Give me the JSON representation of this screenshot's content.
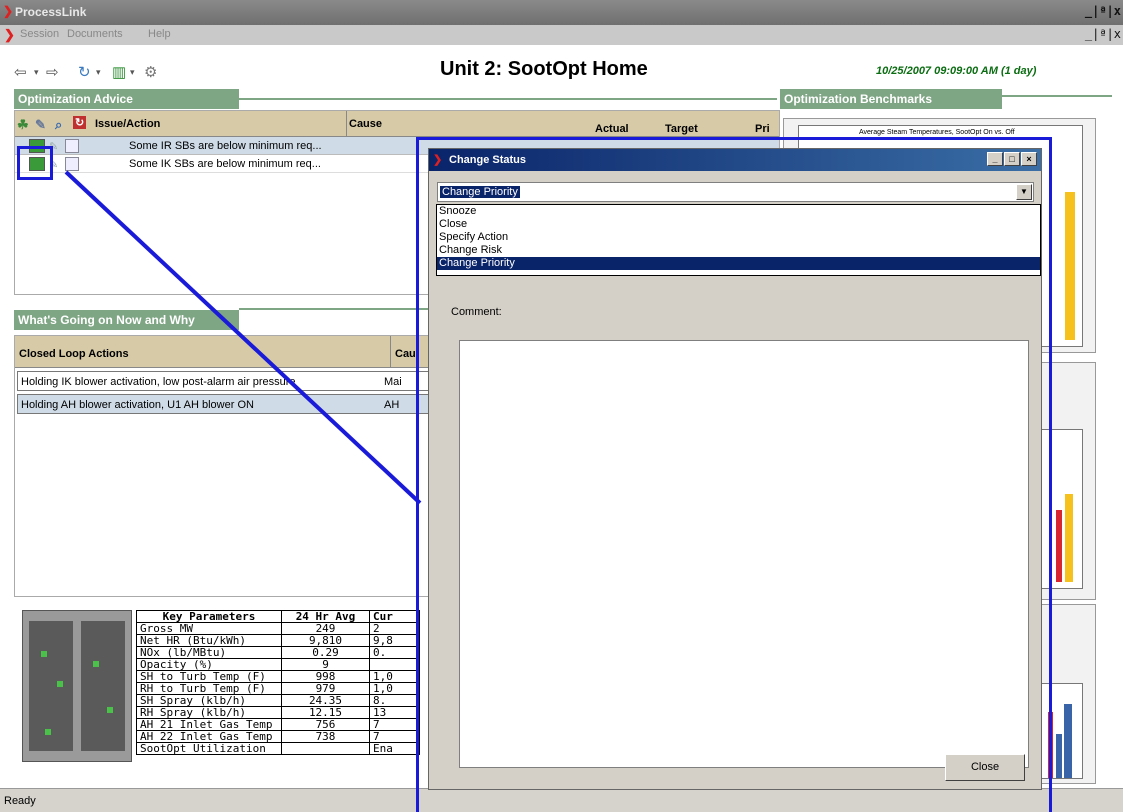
{
  "window": {
    "title": "ProcessLink",
    "controls": "_|ª|x"
  },
  "menu": {
    "items": [
      "Session",
      "Documents",
      "Help"
    ],
    "controls": "_|ª|x"
  },
  "toolbar": {
    "icons": [
      "back-arrow-icon",
      "forward-arrow-icon",
      "refresh-icon",
      "chart-icon",
      "settings-icon"
    ]
  },
  "header": {
    "title": "Unit 2: SootOpt Home",
    "datetime": "10/25/2007 09:09:00 AM (1 day)"
  },
  "optimization_advice": {
    "title": "Optimization Advice",
    "columns": [
      "Issue/Action",
      "Cause",
      "Actual",
      "Target",
      "Pri"
    ],
    "rows": [
      {
        "issue": "Some IR SBs are below minimum req..."
      },
      {
        "issue": "Some IK SBs are below minimum req..."
      }
    ]
  },
  "benchmarks": {
    "title": "Optimization Benchmarks",
    "chart1_title": "Average Steam Temperatures, SootOpt On vs. Off",
    "colors": {
      "yellow": "#f6c11c",
      "red": "#d7262f",
      "blue": "#3a64a8"
    }
  },
  "whats_going_on": {
    "title": "What's Going on Now and Why",
    "columns": [
      "Closed Loop Actions",
      "Cau"
    ],
    "rows": [
      {
        "action": "Holding IK blower activation, low post-alarm air pressure",
        "cause": "Mai"
      },
      {
        "action": "Holding AH blower activation, U1 AH blower ON",
        "cause": "AH"
      }
    ]
  },
  "key_parameters": {
    "headers": [
      "Key Parameters",
      "24 Hr Avg",
      "Cur"
    ],
    "rows": [
      [
        "Gross MW",
        "249",
        "2"
      ],
      [
        "Net HR (Btu/kWh)",
        "9,810",
        "9,8"
      ],
      [
        "NOx (lb/MBtu)",
        "0.29",
        "0."
      ],
      [
        "Opacity (%)",
        "9",
        ""
      ],
      [
        "SH to Turb Temp (F)",
        "998",
        "1,0"
      ],
      [
        "RH to Turb Temp (F)",
        "979",
        "1,0"
      ],
      [
        "SH Spray (klb/h)",
        "24.35",
        "8."
      ],
      [
        "RH Spray (klb/h)",
        "12.15",
        "13"
      ],
      [
        "AH 21 Inlet Gas Temp",
        "756",
        "7"
      ],
      [
        "AH 22 Inlet Gas Temp",
        "738",
        "7"
      ],
      [
        "SootOpt Utilization",
        "",
        "Ena"
      ]
    ]
  },
  "dialog": {
    "title": "Change Status",
    "selected": "Change Priority",
    "options": [
      "Snooze",
      "Close",
      "Specify Action",
      "Change Risk",
      "Change Priority"
    ],
    "comment_label": "Comment:",
    "comment_value": "",
    "close_label": "Close"
  },
  "status": {
    "text": "Ready"
  }
}
